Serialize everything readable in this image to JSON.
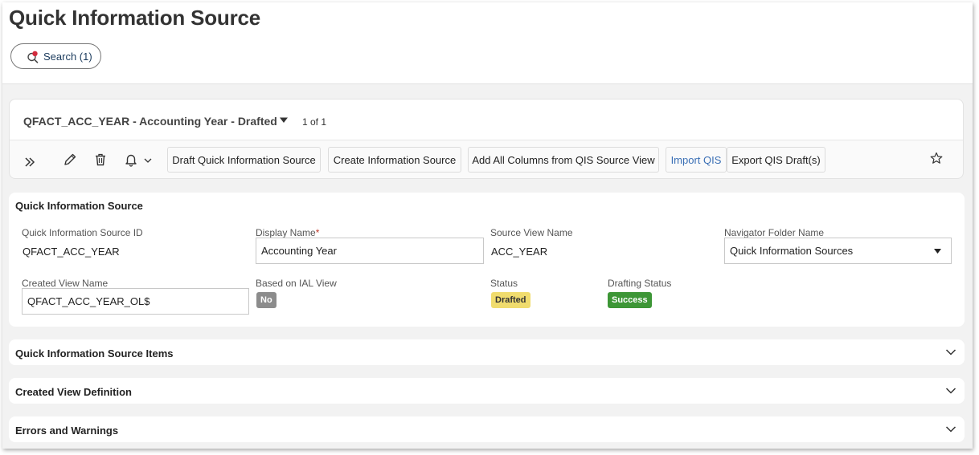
{
  "page": {
    "title": "Quick Information Source",
    "search_label": "Search (1)"
  },
  "record": {
    "title": "QFACT_ACC_YEAR - Accounting Year - Drafted",
    "count": "1 of 1"
  },
  "toolbar": {
    "icons": [
      "expand-icon",
      "edit-pencil-icon",
      "delete-trash-icon",
      "notification-bell-icon",
      "chevron-down-icon",
      "star-icon"
    ],
    "buttons": {
      "draft": "Draft Quick Information Source",
      "create": "Create Information Source",
      "add_all": "Add All Columns from QIS Source View",
      "import": "Import QIS",
      "export": "Export QIS Draft(s)"
    },
    "import_color": "#3a6fb5"
  },
  "details": {
    "section_title": "Quick Information Source",
    "qis_id": {
      "label": "Quick Information Source ID",
      "value": "QFACT_ACC_YEAR"
    },
    "display_name": {
      "label": "Display Name",
      "required_mark": "*",
      "value": "Accounting Year"
    },
    "source_view": {
      "label": "Source View Name",
      "value": "ACC_YEAR"
    },
    "navigator_folder": {
      "label": "Navigator Folder Name",
      "value": "Quick Information Sources"
    },
    "created_view": {
      "label": "Created View Name",
      "value": "QFACT_ACC_YEAR_OL$"
    },
    "based_on_ial": {
      "label": "Based on IAL View",
      "value": "No"
    },
    "status": {
      "label": "Status",
      "value": "Drafted"
    },
    "drafting_status": {
      "label": "Drafting Status",
      "value": "Success"
    }
  },
  "status_colors": {
    "no": "#8c8c8c",
    "drafted": "#f0dc6e",
    "success": "#3d9636"
  },
  "sections": {
    "items": "Quick Information Source Items",
    "view_definition": "Created View Definition",
    "errors": "Errors and Warnings"
  }
}
